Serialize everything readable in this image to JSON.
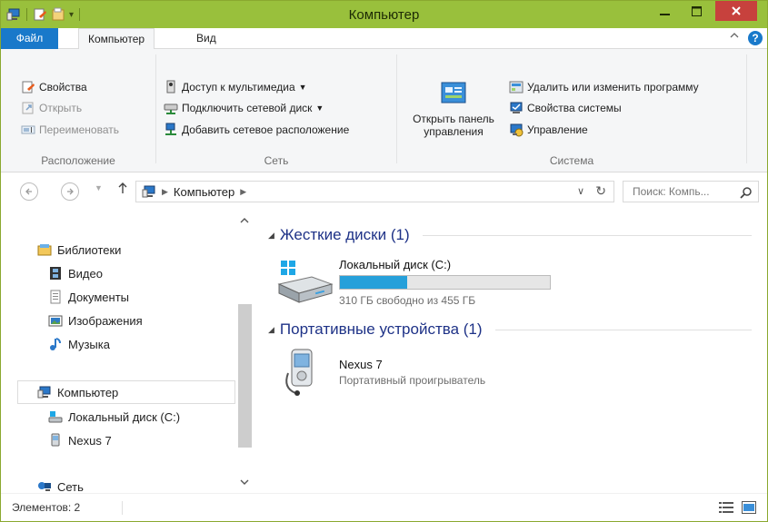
{
  "window": {
    "title": "Компьютер"
  },
  "ribbon": {
    "tabs": {
      "file": "Файл",
      "computer": "Компьютер",
      "view": "Вид"
    },
    "location": {
      "properties": "Свойства",
      "open": "Открыть",
      "rename": "Переименовать",
      "label": "Расположение"
    },
    "network": {
      "media_access": "Доступ к мультимедиа",
      "map_drive": "Подключить сетевой диск",
      "add_location": "Добавить сетевое расположение",
      "label": "Сеть"
    },
    "system": {
      "open_panel_line1": "Открыть панель",
      "open_panel_line2": "управления",
      "uninstall": "Удалить или изменить программу",
      "sys_props": "Свойства системы",
      "manage": "Управление",
      "label": "Система"
    }
  },
  "address": {
    "crumb": "Компьютер",
    "search_placeholder": "Поиск: Компь..."
  },
  "navpane": {
    "libraries": "Библиотеки",
    "video": "Видео",
    "documents": "Документы",
    "images": "Изображения",
    "music": "Музыка",
    "computer": "Компьютер",
    "local_disk": "Локальный диск (C:)",
    "nexus": "Nexus 7",
    "network": "Сеть"
  },
  "content": {
    "hard_disks_title": "Жесткие диски (1)",
    "drive_name": "Локальный диск (C:)",
    "drive_free": "310 ГБ свободно из 455 ГБ",
    "drive_used_fraction": 0.32,
    "portable_title": "Портативные устройства (1)",
    "device_name": "Nexus 7",
    "device_type": "Портативный проигрыватель"
  },
  "status": {
    "items": "Элементов: 2"
  },
  "colors": {
    "titlebar": "#99c03c",
    "accent": "#1979ca",
    "close": "#c7413d",
    "progress": "#26a0da",
    "section": "#1e3287"
  }
}
